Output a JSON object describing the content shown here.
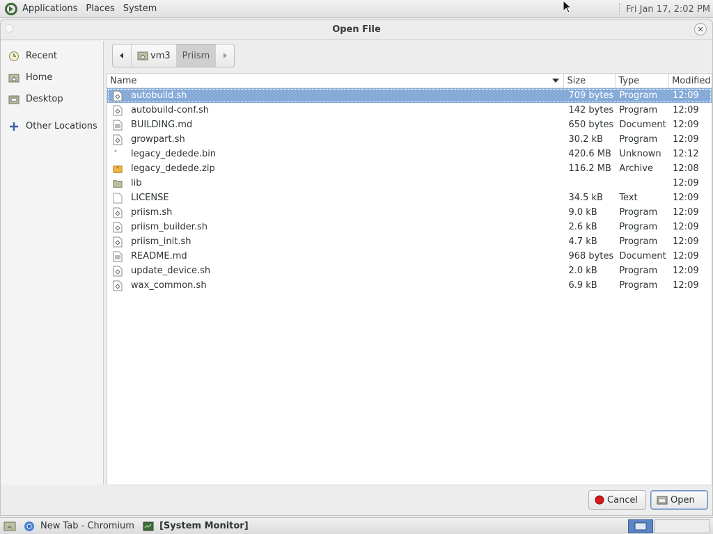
{
  "top_panel": {
    "menus": [
      "Applications",
      "Places",
      "System"
    ],
    "clock": "Fri Jan 17,  2:02 PM"
  },
  "dialog": {
    "title": "Open File"
  },
  "sidebar": {
    "items": [
      {
        "label": "Recent",
        "icon": "recent-icon"
      },
      {
        "label": "Home",
        "icon": "home-folder-icon"
      },
      {
        "label": "Desktop",
        "icon": "desktop-folder-icon"
      },
      {
        "label": "Other Locations",
        "icon": "plus-icon"
      }
    ]
  },
  "pathbar": {
    "segments": [
      "vm3",
      "Priism"
    ]
  },
  "filelist": {
    "columns": [
      "Name",
      "Size",
      "Type",
      "Modified"
    ],
    "rows": [
      {
        "name": "autobuild.sh",
        "size": "709 bytes",
        "type": "Program",
        "modified": "12:09",
        "icon": "script-icon",
        "selected": true
      },
      {
        "name": "autobuild-conf.sh",
        "size": "142 bytes",
        "type": "Program",
        "modified": "12:09",
        "icon": "script-icon"
      },
      {
        "name": "BUILDING.md",
        "size": "650 bytes",
        "type": "Document",
        "modified": "12:09",
        "icon": "document-icon"
      },
      {
        "name": "growpart.sh",
        "size": "30.2 kB",
        "type": "Program",
        "modified": "12:09",
        "icon": "script-icon"
      },
      {
        "name": "legacy_dedede.bin",
        "size": "420.6 MB",
        "type": "Unknown",
        "modified": "12:12",
        "icon": "binary-icon"
      },
      {
        "name": "legacy_dedede.zip",
        "size": "116.2 MB",
        "type": "Archive",
        "modified": "12:08",
        "icon": "archive-icon"
      },
      {
        "name": "lib",
        "size": "",
        "type": "",
        "modified": "12:09",
        "icon": "folder-icon"
      },
      {
        "name": "LICENSE",
        "size": "34.5 kB",
        "type": "Text",
        "modified": "12:09",
        "icon": "text-icon"
      },
      {
        "name": "priism.sh",
        "size": "9.0 kB",
        "type": "Program",
        "modified": "12:09",
        "icon": "script-icon"
      },
      {
        "name": "priism_builder.sh",
        "size": "2.6 kB",
        "type": "Program",
        "modified": "12:09",
        "icon": "script-icon"
      },
      {
        "name": "priism_init.sh",
        "size": "4.7 kB",
        "type": "Program",
        "modified": "12:09",
        "icon": "script-icon"
      },
      {
        "name": "README.md",
        "size": "968 bytes",
        "type": "Document",
        "modified": "12:09",
        "icon": "document-icon"
      },
      {
        "name": "update_device.sh",
        "size": "2.0 kB",
        "type": "Program",
        "modified": "12:09",
        "icon": "script-icon"
      },
      {
        "name": "wax_common.sh",
        "size": "6.9 kB",
        "type": "Program",
        "modified": "12:09",
        "icon": "script-icon"
      }
    ]
  },
  "buttons": {
    "cancel": "Cancel",
    "open": "Open"
  },
  "taskbar": {
    "tasks": [
      {
        "label": "New Tab - Chromium",
        "icon": "chromium-icon"
      },
      {
        "label": "[System Monitor]",
        "icon": "system-monitor-icon"
      }
    ]
  },
  "colors": {
    "selection": "#86abd9",
    "panel": "#e6e6e6"
  }
}
